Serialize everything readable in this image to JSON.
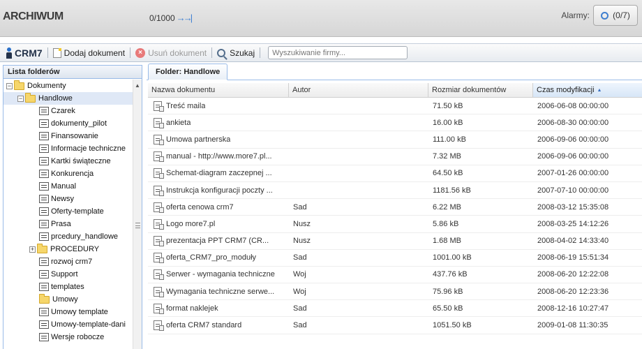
{
  "header": {
    "title": "ARCHIWUM",
    "counter": "0/1000",
    "alarms_label": "Alarmy:",
    "alarms_count": "(0/7)"
  },
  "toolbar": {
    "logo": "CRM7",
    "add_document": "Dodaj dokument",
    "delete_document": "Usuń dokument",
    "search": "Szukaj",
    "company_search_placeholder": "Wyszukiwanie firmy..."
  },
  "folders": {
    "panel_title": "Lista folderów",
    "root": "Dokumenty",
    "selected": "Handlowe",
    "items": [
      "Czarek",
      "dokumenty_pilot",
      "Finansowanie",
      "Informacje techniczne",
      "Kartki świąteczne",
      "Konkurencja",
      "Manual",
      "Newsy",
      "Oferty-template",
      "Prasa",
      "prcedury_handlowe",
      "PROCEDURY",
      "rozwoj crm7",
      "Support",
      "templates",
      "Umowy",
      "Umowy template",
      "Umowy-template-dani",
      "Wersje robocze"
    ]
  },
  "main": {
    "tab_label": "Folder: Handlowe",
    "columns": [
      "Nazwa dokumentu",
      "Autor",
      "Rozmiar dokumentów",
      "Czas modyfikacji"
    ],
    "rows": [
      {
        "name": "Treść maila",
        "author": "",
        "size": "71.50 kB",
        "modified": "2006-06-08 00:00:00"
      },
      {
        "name": "ankieta",
        "author": "",
        "size": "16.00 kB",
        "modified": "2006-08-30 00:00:00"
      },
      {
        "name": "Umowa partnerska",
        "author": "",
        "size": "111.00 kB",
        "modified": "2006-09-06 00:00:00"
      },
      {
        "name": "manual - http://www.more7.pl...",
        "author": "",
        "size": "7.32 MB",
        "modified": "2006-09-06 00:00:00"
      },
      {
        "name": "Schemat-diagram zaczepnej ...",
        "author": "",
        "size": "64.50 kB",
        "modified": "2007-01-26 00:00:00"
      },
      {
        "name": "Instrukcja konfiguracji poczty ...",
        "author": "",
        "size": "1181.56 kB",
        "modified": "2007-07-10 00:00:00"
      },
      {
        "name": "oferta cenowa crm7",
        "author": "Sad",
        "size": "6.22 MB",
        "modified": "2008-03-12 15:35:08"
      },
      {
        "name": "Logo more7.pl",
        "author": "Nusz",
        "size": "5.86 kB",
        "modified": "2008-03-25 14:12:26"
      },
      {
        "name": "prezentacja PPT CRM7 (CR...",
        "author": "Nusz",
        "size": "1.68 MB",
        "modified": "2008-04-02 14:33:40"
      },
      {
        "name": "oferta_CRM7_pro_moduły",
        "author": "Sad",
        "size": "1001.00 kB",
        "modified": "2008-06-19 15:51:34"
      },
      {
        "name": "Serwer - wymagania techniczne",
        "author": "Woj",
        "size": "437.76 kB",
        "modified": "2008-06-20 12:22:08"
      },
      {
        "name": "Wymagania techniczne serwe...",
        "author": "Woj",
        "size": "75.96 kB",
        "modified": "2008-06-20 12:23:36"
      },
      {
        "name": "format naklejek",
        "author": "Sad",
        "size": "65.50 kB",
        "modified": "2008-12-16 10:27:47"
      },
      {
        "name": "oferta CRM7 standard",
        "author": "Sad",
        "size": "1051.50 kB",
        "modified": "2009-01-08 11:30:35"
      }
    ]
  }
}
